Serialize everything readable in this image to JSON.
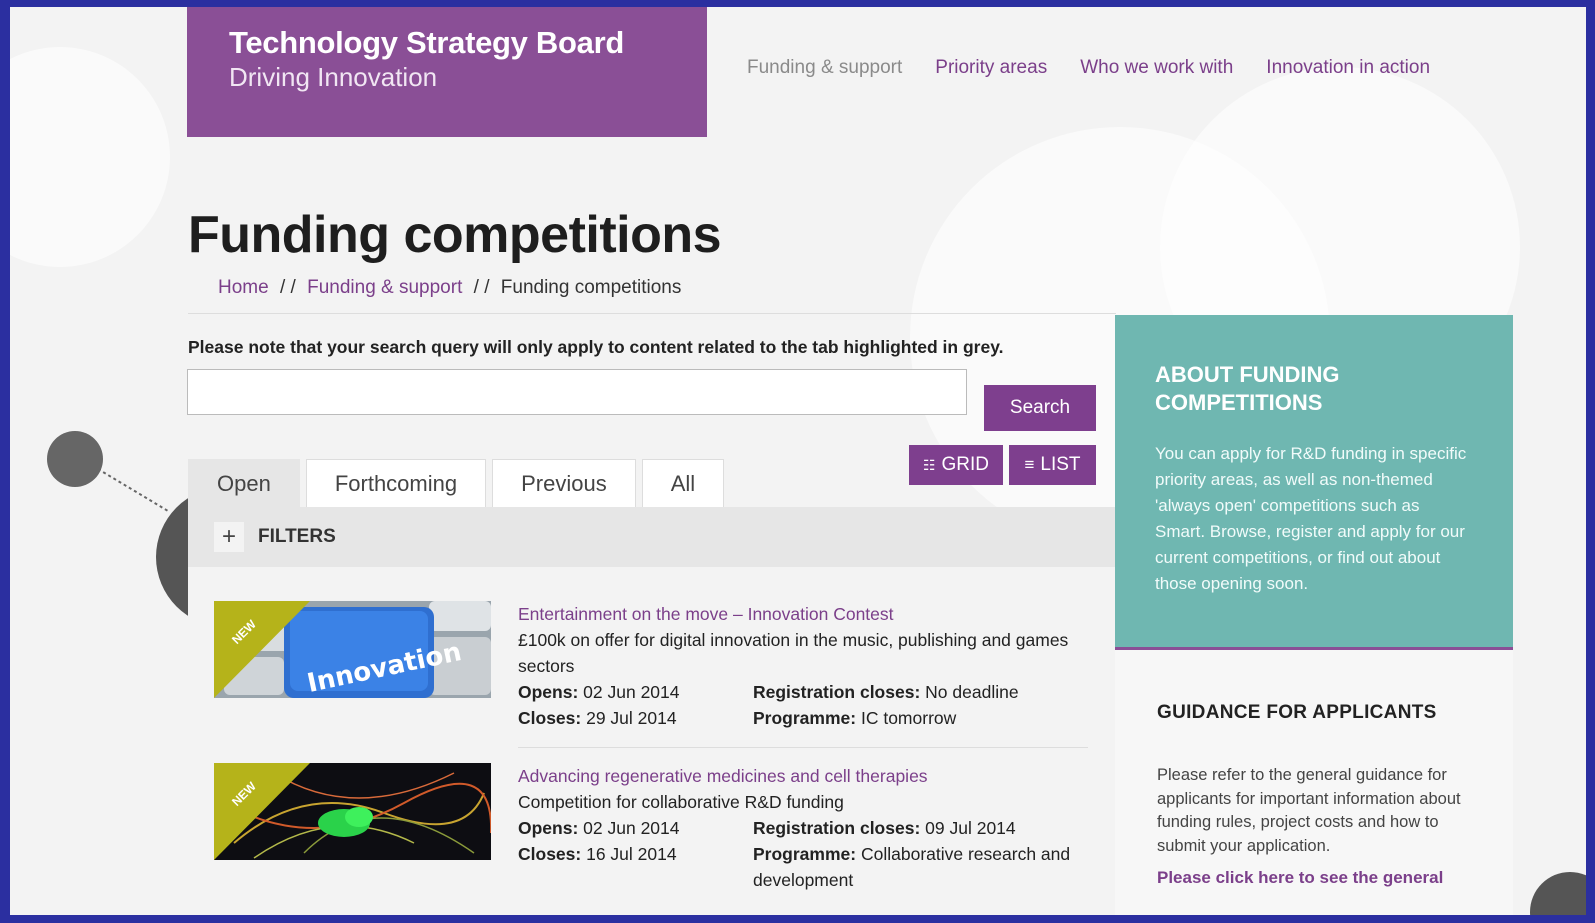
{
  "logo": {
    "line1": "Technology Strategy Board",
    "line2": "Driving Innovation"
  },
  "topnav": [
    {
      "label": "Funding & support",
      "active": true
    },
    {
      "label": "Priority areas",
      "active": false
    },
    {
      "label": "Who we work with",
      "active": false
    },
    {
      "label": "Innovation in action",
      "active": false
    }
  ],
  "page": {
    "title": "Funding competitions"
  },
  "breadcrumb": {
    "home": "Home",
    "sep": "/ /",
    "funding": "Funding & support",
    "current": "Funding competitions"
  },
  "search": {
    "note": "Please note that your search query will only apply to content related to the tab highlighted in grey.",
    "placeholder": "",
    "button": "Search"
  },
  "view_toggle": {
    "grid": "GRID",
    "list": "LIST",
    "grid_icon": "grid-icon",
    "list_icon": "list-icon"
  },
  "tabs": [
    {
      "label": "Open",
      "active": true
    },
    {
      "label": "Forthcoming",
      "active": false
    },
    {
      "label": "Previous",
      "active": false
    },
    {
      "label": "All",
      "active": false
    }
  ],
  "filters": {
    "toggle": "+",
    "label": "FILTERS"
  },
  "competitions": [
    {
      "badge": "NEW",
      "thumb_text": "Innovation",
      "title": "Entertainment on the move – Innovation Contest",
      "description": "£100k on offer for digital innovation in the music, publishing and games sectors",
      "opens_label": "Opens:",
      "opens": "02 Jun 2014",
      "closes_label": "Closes:",
      "closes": "29 Jul 2014",
      "reg_label": "Registration closes:",
      "reg": "No deadline",
      "prog_label": "Programme:",
      "prog": "IC tomorrow"
    },
    {
      "badge": "NEW",
      "thumb_text": "",
      "title": "Advancing regenerative medicines and cell therapies",
      "description": "Competition for collaborative R&D funding",
      "opens_label": "Opens:",
      "opens": "02 Jun 2014",
      "closes_label": "Closes:",
      "closes": "16 Jul 2014",
      "reg_label": "Registration closes:",
      "reg": "09 Jul 2014",
      "prog_label": "Programme:",
      "prog": "Collaborative research and development"
    }
  ],
  "sidebar": {
    "about_title": "ABOUT FUNDING COMPETITIONS",
    "about_text": "You can apply for R&D funding in specific priority areas, as well as non-themed 'always open' competitions such as Smart. Browse, register and apply for our current competitions, or find out about those opening soon.",
    "guidance_title": "GUIDANCE FOR APPLICANTS",
    "guidance_text": "Please refer to the general guidance for applicants for important information about funding rules, project costs and how to submit your application.",
    "guidance_link": "Please click here to see the general"
  },
  "colors": {
    "brand_purple": "#8a4f96",
    "teal": "#6fb7b1",
    "link": "#7b3f8a",
    "badge": "#b5b31a"
  }
}
